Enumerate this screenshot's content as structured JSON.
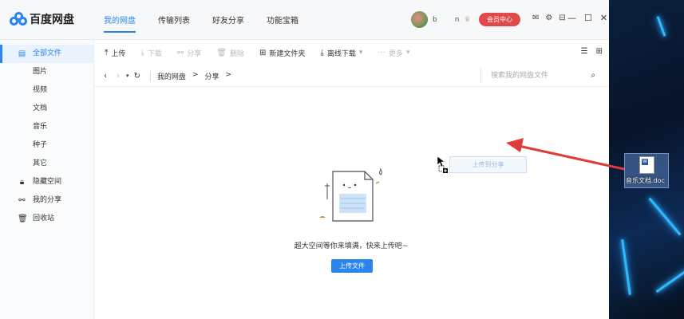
{
  "app": {
    "logo_text": "百度网盘",
    "nav": [
      "我的网盘",
      "传输列表",
      "好友分享",
      "功能宝箱"
    ],
    "user_name": "b",
    "user_suffix": "n",
    "vip_label": "会员中心",
    "top_icons": [
      "mail-icon",
      "settings-icon",
      "skin-icon"
    ],
    "window_controls": [
      "minimize-icon",
      "maximize-icon",
      "close-icon"
    ]
  },
  "sidebar": {
    "items": [
      {
        "label": "全部文件",
        "icon": "file-icon",
        "active": true
      },
      {
        "label": "图片"
      },
      {
        "label": "视频"
      },
      {
        "label": "文档"
      },
      {
        "label": "音乐"
      },
      {
        "label": "种子"
      },
      {
        "label": "其它"
      },
      {
        "label": "隐藏空间",
        "icon": "lock-icon"
      },
      {
        "label": "我的分享",
        "icon": "share-icon"
      },
      {
        "label": "回收站",
        "icon": "trash-icon"
      }
    ]
  },
  "toolbar": {
    "upload": "上传",
    "download": "下载",
    "share": "分享",
    "delete": "删除",
    "new_folder": "新建文件夹",
    "offline_download": "离线下载",
    "more": "更多"
  },
  "path": {
    "crumbs": [
      "我的网盘",
      ">",
      "分享",
      ">"
    ],
    "search_placeholder": "搜索我的网盘文件"
  },
  "empty": {
    "message": "超大空间等你来填满，快来上传吧~",
    "upload_button": "上传文件"
  },
  "drag": {
    "tooltip": "上传到分享"
  },
  "desktop": {
    "file_name": "音乐文档.doc"
  },
  "colors": {
    "accent": "#2a86ee",
    "vip": "#e24a4a",
    "arrow": "#e03a3a"
  }
}
